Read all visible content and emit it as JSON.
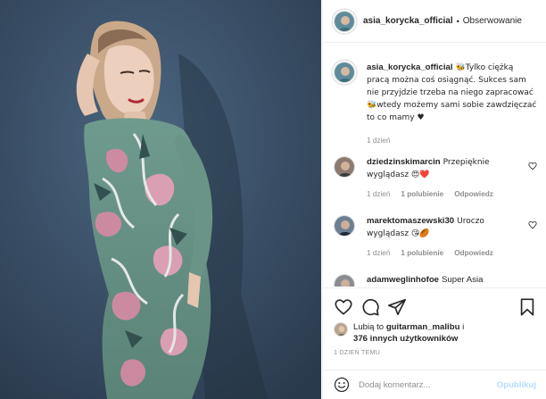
{
  "post": {
    "author": "asia_korycka_official",
    "separator": "•",
    "follow_label": "Obserwowanie",
    "caption_user": "asia_korycka_official",
    "caption_text": "🐝Tylko ciężką pracą można coś osiągnąć. Sukces sam nie przyjdzie trzeba na niego zapracować 🐝wtedy możemy sami sobie zawdzięczać to co mamy ♥",
    "caption_time": "1 dzień"
  },
  "comments": [
    {
      "user": "dziedzinskimarcin",
      "text": "Przepięknie wyglądasz 😍❤️",
      "time": "1 dzień",
      "likes": "1 polubienie",
      "reply": "Odpowiedz"
    },
    {
      "user": "marektomaszewski30",
      "text": "Uroczo wyglądasz 😘🏉",
      "time": "1 dzień",
      "likes": "1 polubienie",
      "reply": "Odpowiedz"
    },
    {
      "user": "adamweglinhofoe",
      "text": "Super Asia"
    }
  ],
  "likes": {
    "prefix": "Lubią to",
    "user": "guitarman_malibu",
    "suffix": "i",
    "others": "376 innych użytkowników"
  },
  "posted": "1 DZIEŃ TEMU",
  "add_comment": {
    "placeholder": "Dodaj komentarz...",
    "submit_label": "Opublikuj"
  },
  "icons": {
    "like": "heart-icon",
    "comment": "comment-icon",
    "share": "share-icon",
    "save": "bookmark-icon",
    "emoji": "smiley-icon",
    "more": "ellipsis-icon"
  },
  "colors": {
    "accent": "#0095f6",
    "accent_disabled": "#b3dbff",
    "muted": "#8e8e8e",
    "border": "#efefef",
    "heart": "#ed4956"
  }
}
